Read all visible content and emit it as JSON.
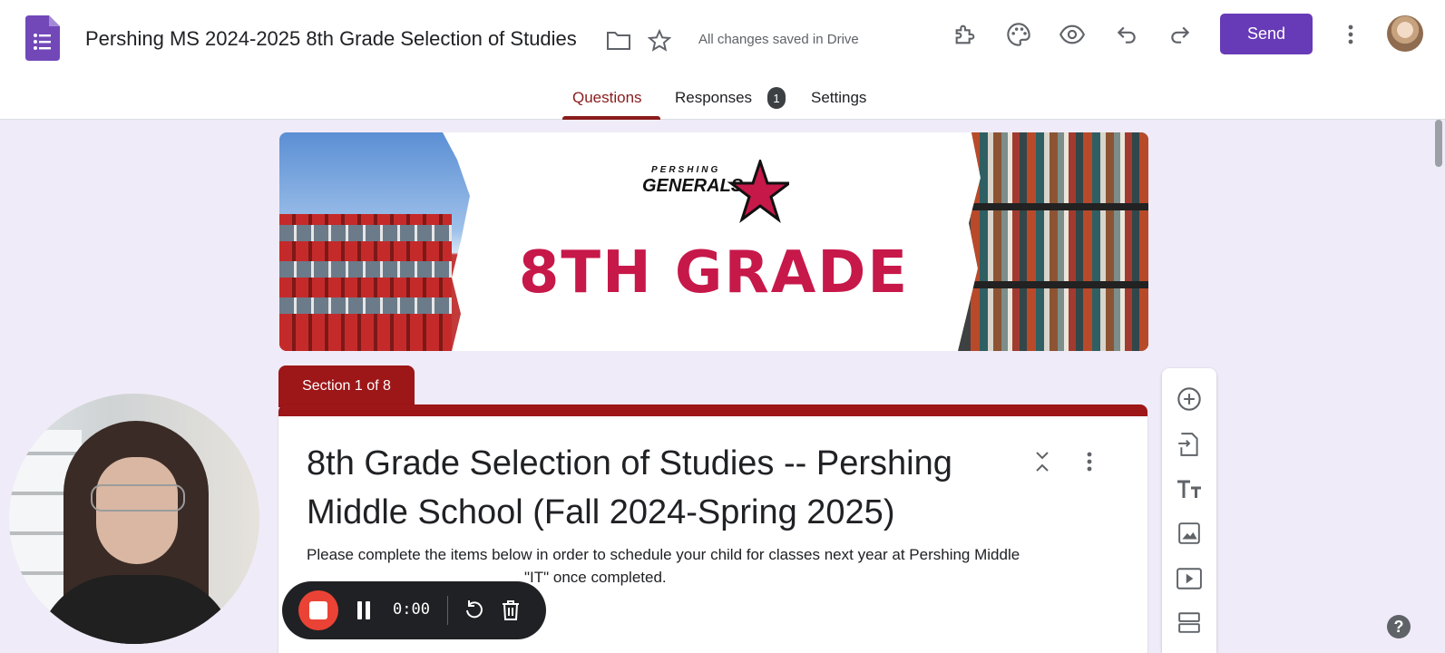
{
  "header": {
    "doc_title": "Pershing MS 2024-2025 8th Grade Selection of Studies",
    "save_status": "All changes saved in Drive",
    "send_label": "Send",
    "icons": [
      "forms-app-icon",
      "folder-icon",
      "star-icon",
      "addons-icon",
      "palette-icon",
      "preview-eye-icon",
      "undo-icon",
      "redo-icon",
      "more-vert-icon"
    ]
  },
  "tabs": [
    {
      "label": "Questions",
      "active": true
    },
    {
      "label": "Responses",
      "badge": "1"
    },
    {
      "label": "Settings"
    }
  ],
  "banner": {
    "logo_small": "PERSHING",
    "logo_big": "GENERALS",
    "headline": "8TH GRADE"
  },
  "section": {
    "label": "Section 1 of 8",
    "title": "8th Grade Selection of Studies -- Pershing Middle School (Fall 2024-Spring 2025)",
    "description_line1": "Please complete the items below in order to schedule your child for classes next year at Pershing Middle",
    "description_line2": "\"IT\" once completed."
  },
  "toolbar": [
    "add-question-icon",
    "import-questions-icon",
    "add-title-icon",
    "add-image-icon",
    "add-video-icon",
    "add-section-icon"
  ],
  "recording": {
    "time": "0:00"
  },
  "help_label": "?",
  "colors": {
    "accent": "#673ab7",
    "theme": "#9d1618",
    "active_tab": "#8a1c1c",
    "background": "#f0ebf8",
    "record": "#ea4335"
  }
}
